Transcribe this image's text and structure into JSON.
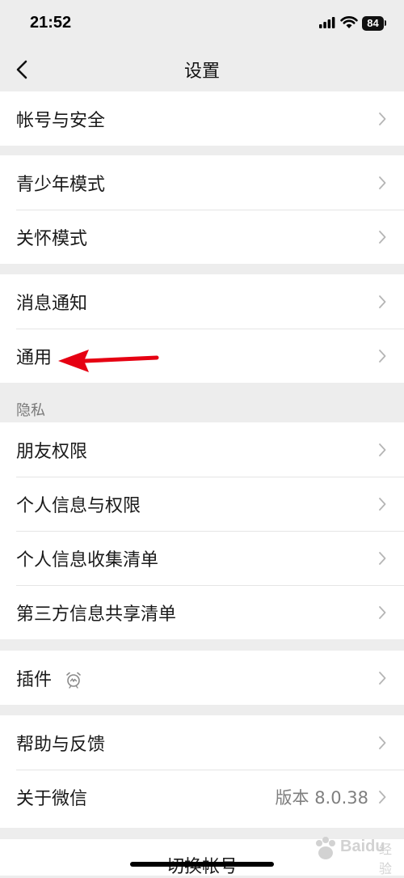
{
  "status_bar": {
    "time": "21:52",
    "battery": "84"
  },
  "nav": {
    "title": "设置"
  },
  "groups": {
    "account": {
      "items": [
        {
          "label": "帐号与安全"
        }
      ]
    },
    "modes": {
      "items": [
        {
          "label": "青少年模式"
        },
        {
          "label": "关怀模式"
        }
      ]
    },
    "notify": {
      "items": [
        {
          "label": "消息通知"
        },
        {
          "label": "通用"
        }
      ]
    },
    "privacy": {
      "section_label": "隐私",
      "items": [
        {
          "label": "朋友权限"
        },
        {
          "label": "个人信息与权限"
        },
        {
          "label": "个人信息收集清单"
        },
        {
          "label": "第三方信息共享清单"
        }
      ]
    },
    "plugins": {
      "items": [
        {
          "label": "插件"
        }
      ]
    },
    "help": {
      "items": [
        {
          "label": "帮助与反馈"
        },
        {
          "label": "关于微信",
          "value": "版本 8.0.38"
        }
      ]
    }
  },
  "bottom": {
    "switch_account": "切换帐号"
  },
  "watermark": {
    "brand": "Baidu",
    "sub": "经验"
  },
  "colors": {
    "background": "#ededed",
    "annotation_arrow": "#e60012"
  },
  "icons": {
    "back": "chevron-left-icon",
    "row_arrow": "chevron-right-icon",
    "plugin": "alarm-clock-icon"
  }
}
